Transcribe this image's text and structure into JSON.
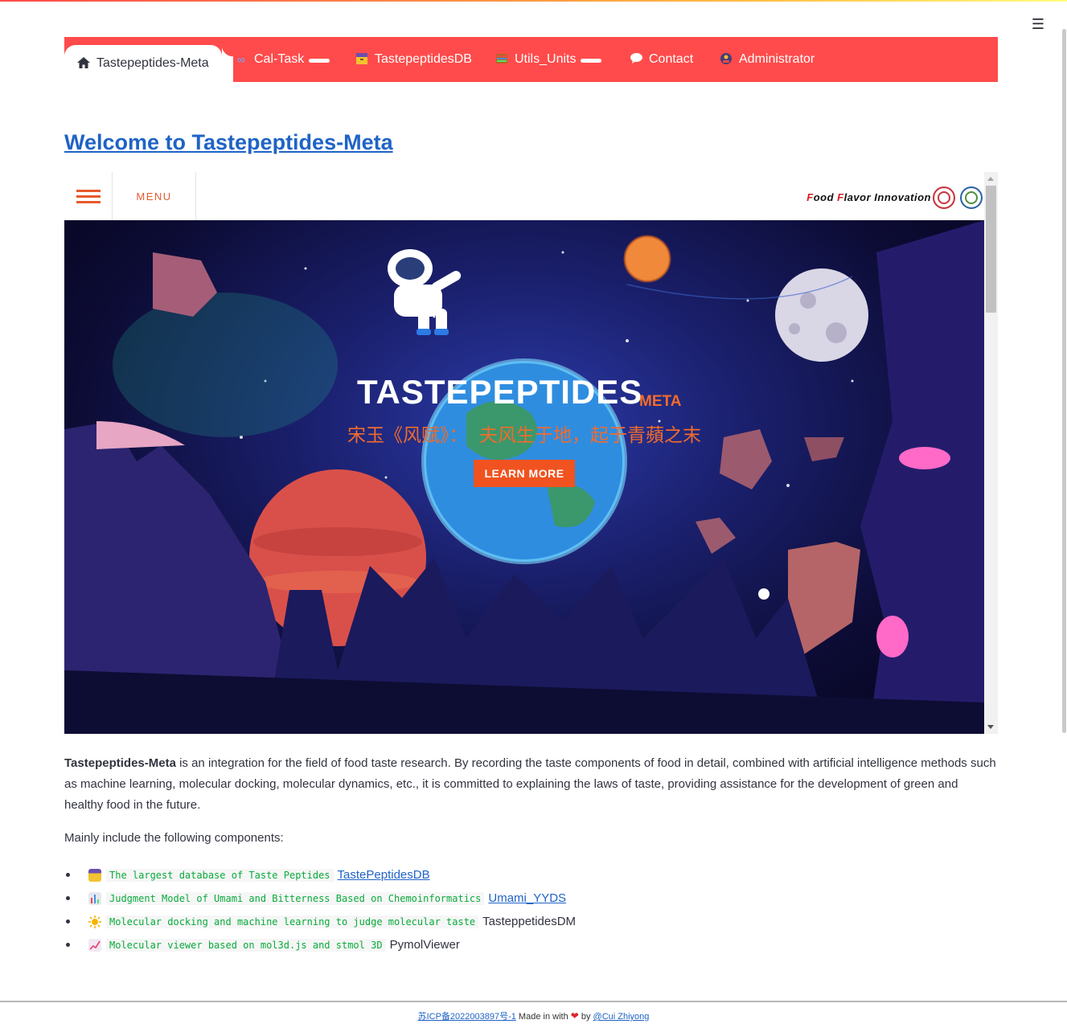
{
  "nav": {
    "tabs": [
      {
        "label": "Tastepeptides-Meta",
        "icon": "home-icon"
      },
      {
        "label": "Cal-Task",
        "icon": "infinity-icon"
      },
      {
        "label": "TastepeptidesDB",
        "icon": "card-file-box-icon"
      },
      {
        "label": "Utils_Units",
        "icon": "abacus-icon"
      },
      {
        "label": "Contact",
        "icon": "speech-bubble-icon"
      },
      {
        "label": "Administrator",
        "icon": "admin-icon"
      }
    ],
    "accent": "#ff4b4b"
  },
  "page": {
    "title": "Welcome to Tastepeptides-Meta"
  },
  "frame": {
    "menu_label": "MENU",
    "brand_text_red1": "F",
    "brand_text1": "ood ",
    "brand_text_red2": "F",
    "brand_text2": "lavor Innovation",
    "hero_title": "TASTEPEPTIDES",
    "hero_sub": "META",
    "hero_quote": "宋玉《风赋》：  夫风生于地，起于青蘋之末",
    "hero_button": "LEARN MORE",
    "hero_accent": "#f0531f"
  },
  "intro": {
    "bold": "Tastepeptides-Meta",
    "text": " is an integration for the field of food taste research. By recording the taste components of food in detail, combined with artificial intelligence methods such as machine learning, molecular docking, molecular dynamics, etc., it is committed to explaining the laws of taste, providing assistance for the development of green and healthy food in the future.",
    "components_heading": "Mainly include the following components:"
  },
  "components": [
    {
      "icon": "card-file-box-icon",
      "code": "The largest database of Taste Peptides",
      "name": "TastePeptidesDB",
      "link": true
    },
    {
      "icon": "bar-chart-icon",
      "code": "Judgment Model of Umami and Bitterness Based on Chemoinformatics",
      "name": "Umami_YYDS",
      "link": true
    },
    {
      "icon": "sun-icon",
      "code": "Molecular docking and machine learning to judge molecular taste",
      "name": "TasteppetidesDM",
      "link": false
    },
    {
      "icon": "chart-increasing-icon",
      "code": "Molecular viewer based on mol3d.js and stmol 3D",
      "name": "PymolViewer",
      "link": false
    }
  ],
  "footer": {
    "icp": "苏ICP备2022003897号-1",
    "made": " Made in with ",
    "by": " by ",
    "author": "@Cui Zhiyong"
  }
}
